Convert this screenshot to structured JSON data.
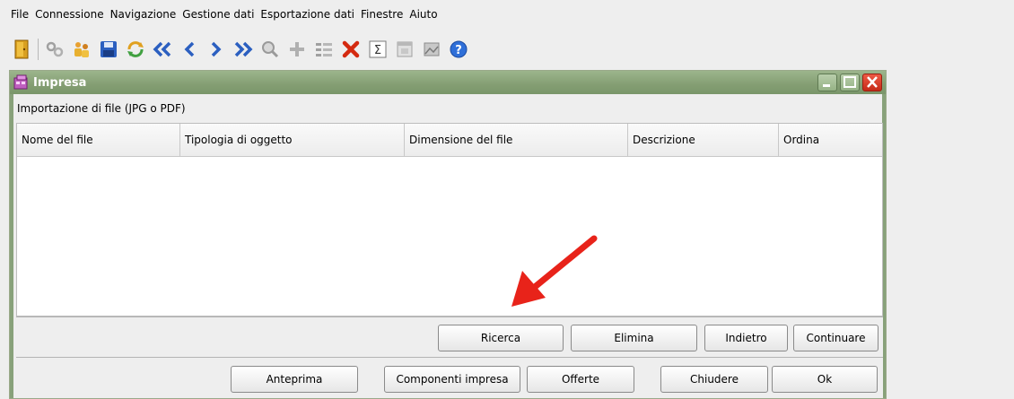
{
  "menubar": {
    "items": [
      "File",
      "Connessione",
      "Navigazione",
      "Gestione dati",
      "Esportazione dati",
      "Finestre",
      "Aiuto"
    ]
  },
  "toolbar": {
    "icons": [
      "exit-icon",
      "tools-icon",
      "users-icon",
      "save-icon",
      "refresh-icon",
      "first-icon",
      "previous-icon",
      "next-icon",
      "last-icon",
      "search-icon",
      "add-icon",
      "list-icon",
      "delete-icon",
      "sum-icon",
      "calendar-icon",
      "image-icon",
      "help-icon"
    ]
  },
  "window": {
    "title": "Impresa",
    "section_label": "Importazione di file (JPG o PDF)",
    "table": {
      "columns": [
        "Nome del file",
        "Tipologia di oggetto",
        "Dimensione del file",
        "Descrizione",
        "Ordina"
      ],
      "rows": []
    },
    "actions_row1": {
      "ricerca": "Ricerca",
      "elimina": "Elimina",
      "indietro": "Indietro",
      "continuare": "Continuare"
    },
    "actions_row2": {
      "anteprima": "Anteprima",
      "componenti_impresa": "Componenti impresa",
      "offerte": "Offerte",
      "chiudere": "Chiudere",
      "ok": "Ok"
    }
  },
  "colors": {
    "titlebar": "#849e73",
    "close_button": "#c52a17",
    "annotation_arrow": "#e8231a"
  }
}
